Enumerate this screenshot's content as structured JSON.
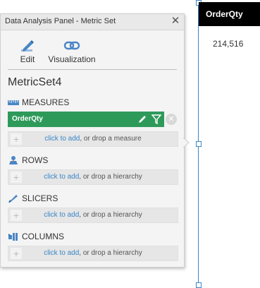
{
  "panel": {
    "title": "Data Analysis Panel - Metric Set",
    "close_glyph": "✕",
    "toolbar": {
      "edit_label": "Edit",
      "visualization_label": "Visualization"
    },
    "metricset_name": "MetricSet4",
    "sections": {
      "measures": {
        "title": "MEASURES",
        "icon": "ruler-icon"
      },
      "rows": {
        "title": "ROWS",
        "icon": "rows-icon"
      },
      "slicers": {
        "title": "SLICERS",
        "icon": "slicer-icon"
      },
      "columns": {
        "title": "COLUMNS",
        "icon": "columns-icon"
      }
    },
    "measure_item": {
      "label": "OrderQty"
    },
    "drop": {
      "link": "click to add",
      "measure_suffix": ", or drop a measure",
      "hierarchy_suffix": ", or drop a hierarchy"
    },
    "colors": {
      "accent_green": "#2e9a5a",
      "link_blue": "#3a86c8",
      "header_black": "#000000"
    }
  },
  "widget": {
    "column_header": "OrderQty",
    "value": "214,516"
  }
}
